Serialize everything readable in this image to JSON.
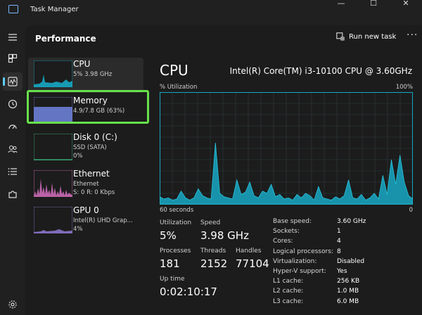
{
  "app": {
    "title": "Task Manager"
  },
  "window": {
    "minimize": "—",
    "maximize": "☐",
    "close": "✕"
  },
  "header": {
    "title": "Performance",
    "run_new_task": "Run new task",
    "more": "···"
  },
  "devices": [
    {
      "name": "CPU",
      "line1": "5% 3.98 GHz",
      "line2": ""
    },
    {
      "name": "Memory",
      "line1": "4.9/7.8 GB (63%)",
      "line2": ""
    },
    {
      "name": "Disk 0 (C:)",
      "line1": "SSD (SATA)",
      "line2": "0%"
    },
    {
      "name": "Ethernet",
      "line1": "Ethernet",
      "line2": "S: 0 R: 0 Kbps"
    },
    {
      "name": "GPU 0",
      "line1": "Intel(R) UHD Grap...",
      "line2": "4%"
    }
  ],
  "detail": {
    "title": "CPU",
    "model": "Intel(R) Core(TM) i3-10100 CPU @ 3.60GHz",
    "util_label": "% Utilization",
    "max_label": "100%",
    "time_label": "60 seconds",
    "min_label": "0",
    "stats": {
      "utilization_label": "Utilization",
      "utilization": "5%",
      "speed_label": "Speed",
      "speed": "3.98 GHz",
      "processes_label": "Processes",
      "processes": "181",
      "threads_label": "Threads",
      "threads": "2152",
      "handles_label": "Handles",
      "handles": "77104",
      "uptime_label": "Up time",
      "uptime": "0:02:10:17"
    },
    "specs": [
      {
        "k": "Base speed:",
        "v": "3.60 GHz"
      },
      {
        "k": "Sockets:",
        "v": "1"
      },
      {
        "k": "Cores:",
        "v": "4"
      },
      {
        "k": "Logical processors:",
        "v": "8"
      },
      {
        "k": "Virtualization:",
        "v": "Disabled"
      },
      {
        "k": "Hyper-V support:",
        "v": "Yes"
      },
      {
        "k": "L1 cache:",
        "v": "256 KB"
      },
      {
        "k": "L2 cache:",
        "v": "1.0 MB"
      },
      {
        "k": "L3 cache:",
        "v": "6.0 MB"
      }
    ]
  },
  "colors": {
    "cpu": "#17a8c4",
    "memory": "#6b7fd6",
    "disk": "#3ab77a",
    "ethernet": "#d66fbf",
    "gpu": "#8b74c9",
    "highlight": "#67e04b"
  },
  "cpu_history": [
    7,
    5,
    6,
    4,
    5,
    12,
    6,
    4,
    6,
    14,
    8,
    6,
    5,
    55,
    10,
    7,
    6,
    5,
    22,
    9,
    11,
    20,
    8,
    6,
    12,
    10,
    18,
    7,
    9,
    5,
    6,
    4,
    9,
    6,
    10,
    8,
    4,
    16,
    6,
    5,
    4,
    7,
    5,
    8,
    22,
    6,
    5,
    9,
    4,
    6,
    10,
    5,
    26,
    9,
    40,
    18,
    44,
    20,
    8,
    5
  ]
}
